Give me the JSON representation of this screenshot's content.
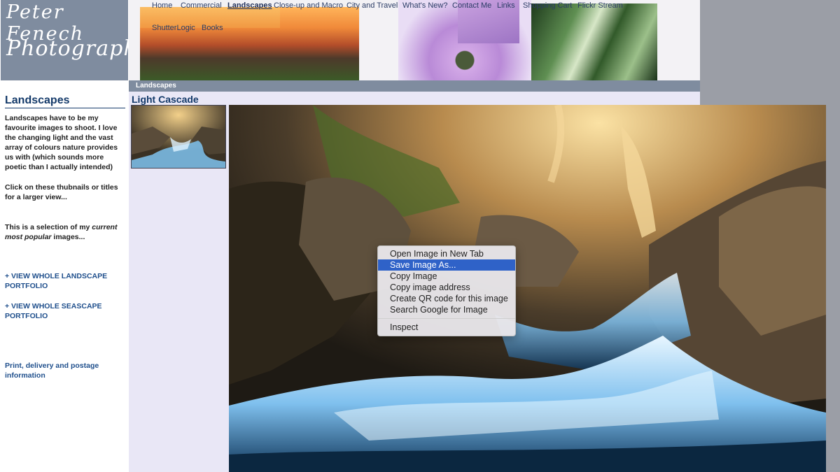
{
  "site": {
    "logo_line1": "Peter Fenech",
    "logo_line2": "Photography"
  },
  "nav": [
    {
      "label": "Home"
    },
    {
      "label": "Commercial"
    },
    {
      "label": "Landscapes"
    },
    {
      "label": "Close-up and Macro"
    },
    {
      "label": "City and Travel"
    },
    {
      "label": "What's New?"
    },
    {
      "label": "Contact Me"
    },
    {
      "label": "Links"
    },
    {
      "label": "Shopping Cart"
    },
    {
      "label": "Flickr Stream"
    },
    {
      "label": "ShutterLogic"
    },
    {
      "label": "Books"
    }
  ],
  "breadcrumb": "Landscapes",
  "sidebar": {
    "title": "Landscapes",
    "intro": "Landscapes have to be my favourite images to shoot. I love the changing light and the vast array of colours nature provides us with (which sounds more poetic than I actually intended)",
    "click_text": "Click on these thubnails or titles for a larger view...",
    "selection_prefix": "This is a selection of my ",
    "selection_emph": "current most popular",
    "selection_suffix": " images...",
    "link_landscape": "+ VIEW WHOLE LANDSCAPE PORTFOLIO",
    "link_seascape": "+ VIEW WHOLE SEASCAPE PORTFOLIO",
    "link_print": "Print, delivery and postage information"
  },
  "main": {
    "image_title": "Light Cascade"
  },
  "context_menu": {
    "items": [
      {
        "label": "Open Image in New Tab"
      },
      {
        "label": "Save Image As..."
      },
      {
        "label": "Copy Image"
      },
      {
        "label": "Copy image address"
      },
      {
        "label": "Create QR code for this image"
      },
      {
        "label": "Search Google for Image"
      },
      {
        "label": "Inspect"
      }
    ],
    "selected_index": 1
  },
  "colors": {
    "header_bg": "#7f8c9f",
    "heading": "#143a6a",
    "main_bg": "#e9e7f6",
    "menu_selected": "#2f62c8"
  }
}
